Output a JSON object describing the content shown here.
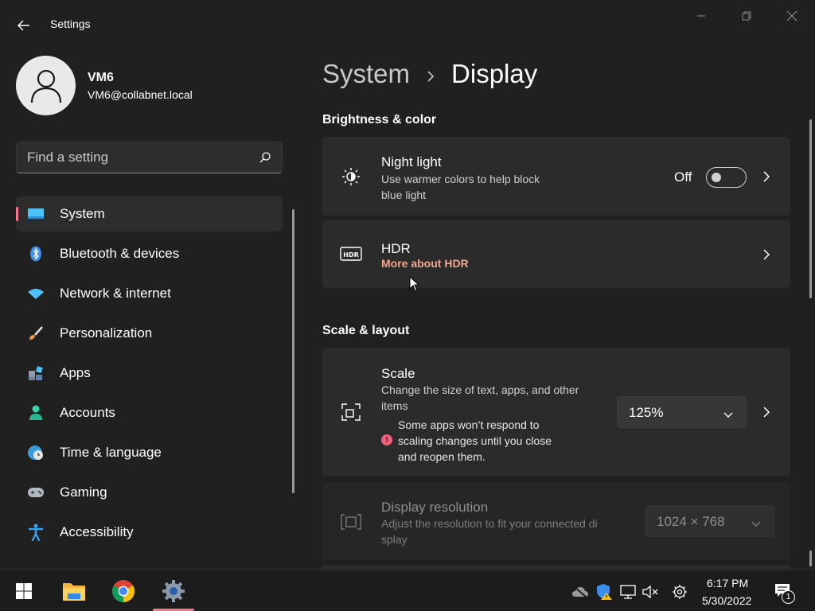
{
  "window": {
    "title": "Settings",
    "controls": [
      "minimize",
      "maximize",
      "close"
    ]
  },
  "user": {
    "name": "VM6",
    "email": "VM6@collabnet.local"
  },
  "search": {
    "placeholder": "Find a setting"
  },
  "nav": {
    "items": [
      {
        "label": "System",
        "icon": "monitor-icon",
        "active": true
      },
      {
        "label": "Bluetooth & devices",
        "icon": "bluetooth-icon"
      },
      {
        "label": "Network & internet",
        "icon": "wifi-icon"
      },
      {
        "label": "Personalization",
        "icon": "brush-icon"
      },
      {
        "label": "Apps",
        "icon": "apps-icon"
      },
      {
        "label": "Accounts",
        "icon": "person-icon"
      },
      {
        "label": "Time & language",
        "icon": "globe-clock-icon"
      },
      {
        "label": "Gaming",
        "icon": "gamepad-icon"
      },
      {
        "label": "Accessibility",
        "icon": "accessibility-icon"
      }
    ]
  },
  "breadcrumb": {
    "parent": "System",
    "separator": "›",
    "current": "Display"
  },
  "sections": {
    "brightness": {
      "heading": "Brightness & color",
      "night_light": {
        "title": "Night light",
        "desc_line1": "Use warmer colors to help block",
        "desc_line2": "blue light",
        "state_label": "Off",
        "on": false
      },
      "hdr": {
        "title": "HDR",
        "link": "More about HDR"
      }
    },
    "scale_layout": {
      "heading": "Scale & layout",
      "scale": {
        "title": "Scale",
        "desc_line1": "Change the size of text, apps, and other",
        "desc_line2": "items",
        "value": "125%",
        "warning_line1": "Some apps won’t respond to",
        "warning_line2": "scaling changes until you close",
        "warning_line3": "and reopen them."
      },
      "resolution": {
        "title": "Display resolution",
        "desc_line1": "Adjust the resolution to fit your connected di",
        "desc_line2": "splay",
        "value": "1024 × 768",
        "disabled": true
      }
    }
  },
  "taskbar": {
    "apps": [
      "start-icon",
      "file-explorer-icon",
      "chrome-icon",
      "settings-icon"
    ],
    "tray": [
      "onedrive-offline-icon",
      "security-warning-icon",
      "network-icon",
      "volume-muted-icon",
      "gear-icon"
    ],
    "time": "6:17 PM",
    "date": "5/30/2022",
    "notification_count": "1"
  },
  "colors": {
    "background": "#202020",
    "card": "#2b2b2b",
    "accent": "#f7768e",
    "link": "#f4a58e"
  }
}
